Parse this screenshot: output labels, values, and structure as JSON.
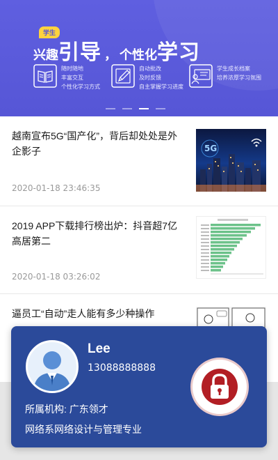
{
  "banner": {
    "tag": "学生",
    "headline_prefix": "兴趣",
    "headline_main": "引导",
    "headline_sep": "，",
    "headline_mid": "个性化",
    "headline_end": "学习",
    "features": [
      {
        "icon": "book-icon",
        "lines": [
          "随时随地",
          "丰富交互",
          "个性化学习方式"
        ]
      },
      {
        "icon": "pencil-icon",
        "lines": [
          "自动批改",
          "及时反馈",
          "自主掌握学习进度"
        ]
      },
      {
        "icon": "profile-board-icon",
        "lines": [
          "学生成长档案",
          "培养浓厚学习氛围"
        ]
      }
    ],
    "slides_total": 4,
    "slide_active": 3
  },
  "news": [
    {
      "title": "越南宣布5G“国产化”，背后却处处是外企影子",
      "time": "2020-01-18 23:46:35",
      "thumb": "city-5g-thumbnail"
    },
    {
      "title": "2019 APP下载排行榜出炉：抖音超7亿高居第二",
      "time": "2020-01-18 03:26:02",
      "thumb": "bar-chart-thumbnail"
    },
    {
      "title": "逼员工“自动”走人能有多少种操作",
      "time": "",
      "thumb": "comic-thumbnail"
    }
  ],
  "profile": {
    "name": "Lee",
    "phone": "13088888888",
    "org": "所属机构: 广东领才",
    "major": "网络系网络设计与管理专业"
  },
  "colors": {
    "banner": "#5a5adb",
    "card": "#2b4a9a",
    "lock": "#b21e24",
    "time_text": "#999999"
  }
}
